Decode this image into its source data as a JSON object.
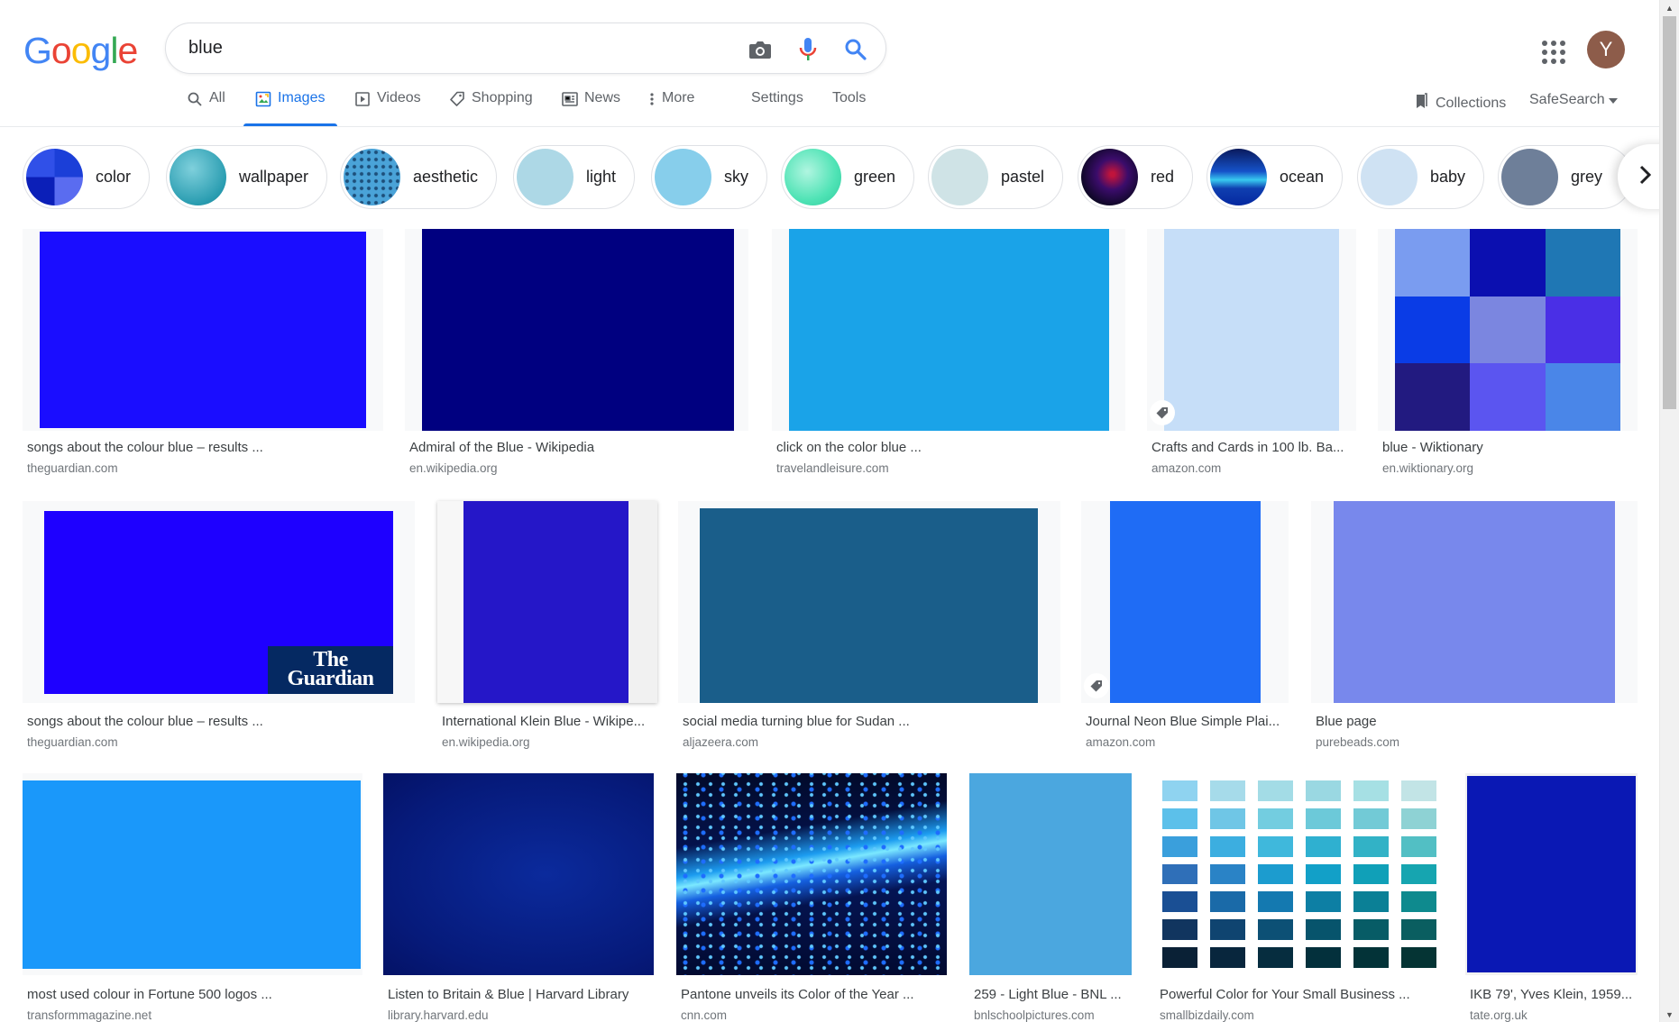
{
  "header": {
    "logo_letters": [
      {
        "ch": "G",
        "color": "#4285f4"
      },
      {
        "ch": "o",
        "color": "#ea4335"
      },
      {
        "ch": "o",
        "color": "#fbbc05"
      },
      {
        "ch": "g",
        "color": "#4285f4"
      },
      {
        "ch": "l",
        "color": "#34a853"
      },
      {
        "ch": "e",
        "color": "#ea4335"
      }
    ],
    "search_query": "blue",
    "avatar_letter": "Y"
  },
  "tabs": [
    {
      "label": "All",
      "icon": "search-icon"
    },
    {
      "label": "Images",
      "icon": "image-icon",
      "active": true
    },
    {
      "label": "Videos",
      "icon": "video-icon"
    },
    {
      "label": "Shopping",
      "icon": "tag-icon"
    },
    {
      "label": "News",
      "icon": "news-icon"
    },
    {
      "label": "More",
      "icon": "more-vert-icon"
    },
    {
      "label": "Settings"
    },
    {
      "label": "Tools"
    }
  ],
  "right_tools": {
    "collections_label": "Collections",
    "safesearch_label": "SafeSearch"
  },
  "chips": [
    {
      "label": "color"
    },
    {
      "label": "wallpaper"
    },
    {
      "label": "aesthetic"
    },
    {
      "label": "light"
    },
    {
      "label": "sky"
    },
    {
      "label": "green"
    },
    {
      "label": "pastel"
    },
    {
      "label": "red"
    },
    {
      "label": "ocean"
    },
    {
      "label": "baby"
    },
    {
      "label": "grey"
    }
  ],
  "results": [
    {
      "title": "songs about the colour blue – results ...",
      "domain": "theguardian.com"
    },
    {
      "title": "Admiral of the Blue - Wikipedia",
      "domain": "en.wikipedia.org"
    },
    {
      "title": "click on the color blue ...",
      "domain": "travelandleisure.com"
    },
    {
      "title": "Crafts and Cards in 100 lb. Ba...",
      "domain": "amazon.com"
    },
    {
      "title": "blue - Wiktionary",
      "domain": "en.wiktionary.org"
    },
    {
      "title": "songs about the colour blue – results ...",
      "domain": "theguardian.com",
      "overlay_text": "The Guardian"
    },
    {
      "title": "International Klein Blue - Wikipe...",
      "domain": "en.wikipedia.org"
    },
    {
      "title": "social media turning blue for Sudan ...",
      "domain": "aljazeera.com"
    },
    {
      "title": "Journal Neon Blue Simple Plai...",
      "domain": "amazon.com"
    },
    {
      "title": "Blue page",
      "domain": "purebeads.com"
    },
    {
      "title": "most used colour in Fortune 500 logos ...",
      "domain": "transformmagazine.net"
    },
    {
      "title": "Listen to Britain & Blue | Harvard Library",
      "domain": "library.harvard.edu"
    },
    {
      "title": "Pantone unveils its Color of the Year ...",
      "domain": "cnn.com"
    },
    {
      "title": "259 - Light Blue - BNL ...",
      "domain": "bnlschoolpictures.com"
    },
    {
      "title": "Powerful Color for Your Small Business ...",
      "domain": "smallbizdaily.com"
    },
    {
      "title": "IKB 79', Yves Klein, 1959...",
      "domain": "tate.org.uk"
    }
  ]
}
